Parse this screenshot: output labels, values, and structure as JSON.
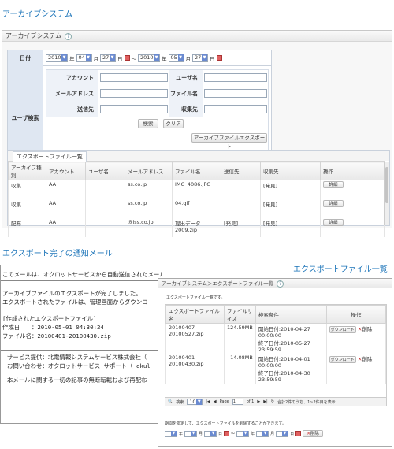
{
  "section_archive": "アーカイブシステム",
  "panel": {
    "title": "アーカイブシステム",
    "help": "?",
    "date": {
      "label": "日付",
      "from": {
        "year": "2010",
        "year_unit": "年",
        "month": "04",
        "month_unit": "月",
        "day": "27",
        "day_unit": "日"
      },
      "sep": "～",
      "to": {
        "year": "2010",
        "year_unit": "年",
        "month": "05",
        "month_unit": "月",
        "day": "27",
        "day_unit": "日"
      }
    },
    "search": {
      "label": "ユーザ検索",
      "account": "アカウント",
      "username": "ユーザ名",
      "mail": "メールアドレス",
      "filename": "ファイル名",
      "sender": "送信先",
      "receiver": "収集先",
      "search_btn": "検索",
      "clear_btn": "クリア",
      "export_btn": "アーカイブファイルエクスポート"
    },
    "list_tab": "エクスポートファイル一覧",
    "columns": [
      "アーカイブ種別",
      "アカウント",
      "ユーザ名",
      "メールアドレス",
      "ファイル名",
      "送信先",
      "収集先",
      "操作"
    ],
    "rows": [
      {
        "type": "収集",
        "account": "AA",
        "user": "",
        "mail": "ss.co.jp",
        "file": "IMG_4086.JPG",
        "to": "",
        "from": "[発見]",
        "op": "詳細"
      },
      {
        "type": "収集",
        "account": "AA",
        "user": "",
        "mail": "ss.co.jp",
        "file": "04.gif",
        "to": "",
        "from": "[発見]",
        "op": "詳細"
      },
      {
        "type": "配布",
        "account": "AA",
        "user": "",
        "mail": "@iss.co.jp",
        "file": "提出データ2009.zip",
        "to": "[発見]",
        "from": "[発見]",
        "op": "詳細"
      }
    ]
  },
  "section_mail": "エクスポート完了の通知メール",
  "section_list": "エクスポートファイル一覧",
  "mail": {
    "l1": "このメールは、オクロットサービスから自動送信されたメールです。",
    "l2": "アーカイブファイルのエクスポートが完了しました。",
    "l3": "エクスポートされたファイルは、管理画面からダウンロ",
    "l4": "[作成されたエクスポートファイル]",
    "l5": "作成日　　：2010-05-01 04:30:24",
    "l6": "ファイル名：20100401-20100430.zip",
    "l7": "サービス提供：北電情報システムサービス株式会社（",
    "l8": "お問い合わせ：オクロットサービス サポート（ okul",
    "l9": "本メールに関する一切の記事の無断転載および再配布"
  },
  "win": {
    "breadcrumb": "アーカイブシステム＞エクスポートファイル一覧",
    "help": "?",
    "intro": "エクスポートファイル一覧です。",
    "columns": [
      "エクスポートファイル名",
      "ファイルサイズ",
      "検索条件",
      "操作"
    ],
    "rows": [
      {
        "name": "20100407-20100527.zip",
        "size": "124.59MB",
        "cond1": "開始日付:2010-04-27 00:00:00",
        "cond2": "終了日付:2010-05-27 23:59:59",
        "dl": "ダウンロード",
        "del": "削除"
      },
      {
        "name": "20100401-20100430.zip",
        "size": "14.08MB",
        "cond1": "開始日付:2010-04-01 00:00:00",
        "cond2": "終了日付:2010-04-30 23:59:59",
        "dl": "ダウンロード",
        "del": "削除"
      }
    ],
    "pager": {
      "search": "検索",
      "per": "10",
      "page_label": "Page",
      "page": "1",
      "of": "of 1",
      "total": "合計2件のうち、1~2件目を表示"
    },
    "bottom_note": "期間を指定して、エクスポートファイルを削除することができます。",
    "bottom_sep": "～",
    "bottom_btn": "削除",
    "bottom_from": {
      "year": "年",
      "month": "月",
      "day": "日"
    },
    "bottom_to": {
      "year": "年",
      "month": "月",
      "day": "日"
    }
  },
  "colors": {
    "accent": "#1a73b8",
    "label_bg": "#dfe7f2"
  }
}
